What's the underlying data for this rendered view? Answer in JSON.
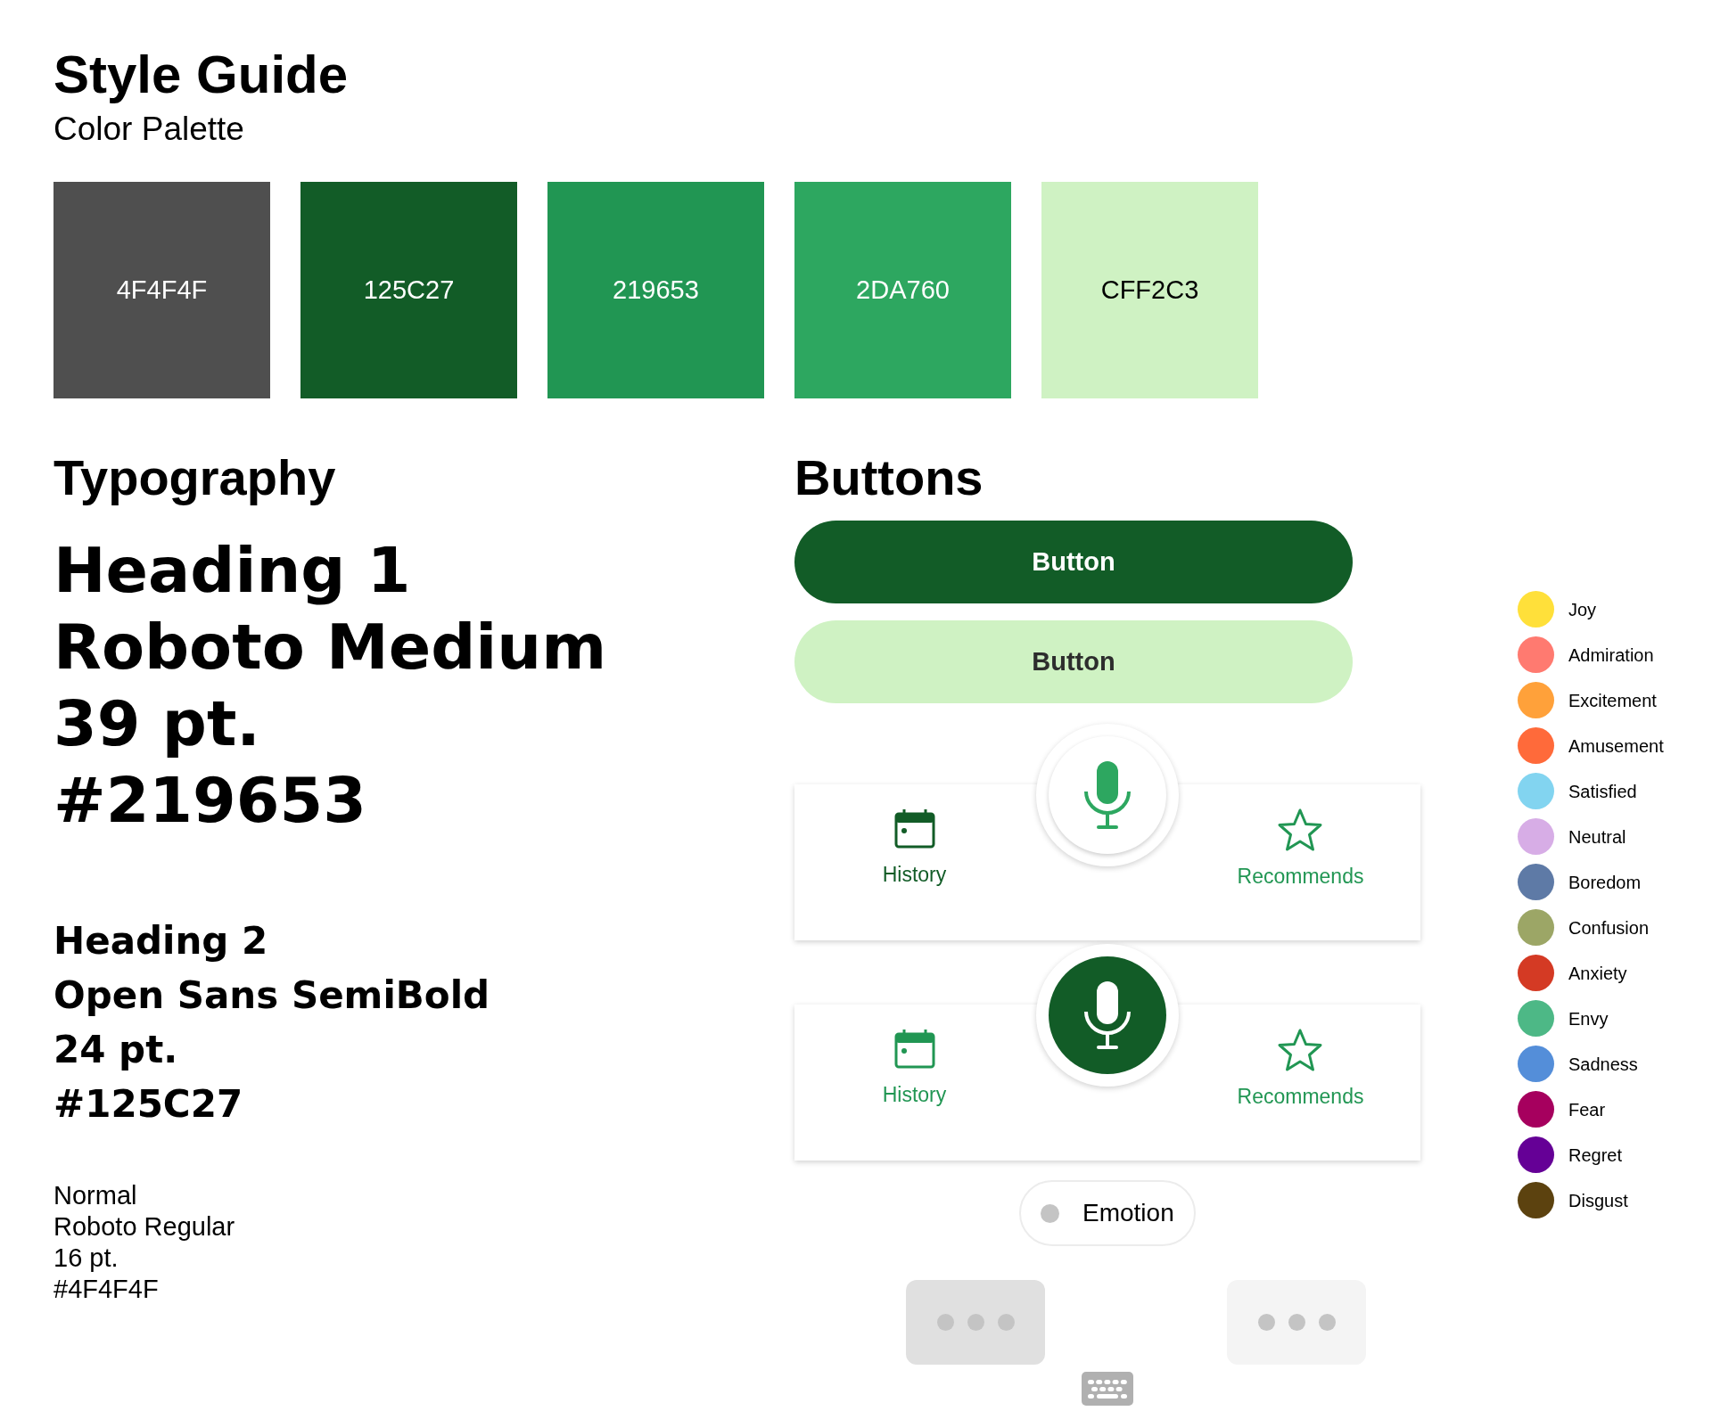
{
  "title": "Style Guide",
  "palette": {
    "heading": "Color Palette",
    "swatches": [
      {
        "label": "4F4F4F",
        "color": "#4f4f4f"
      },
      {
        "label": "125C27",
        "color": "#125c27"
      },
      {
        "label": "219653",
        "color": "#219653"
      },
      {
        "label": "2DA760",
        "color": "#2da760"
      },
      {
        "label": "CFF2C3",
        "color": "#cff2c3"
      }
    ]
  },
  "typography": {
    "heading": "Typography",
    "samples": [
      {
        "kind": "heading1",
        "lines": [
          "Heading 1",
          "Roboto Medium",
          "39 pt.",
          "#219653"
        ]
      },
      {
        "kind": "heading2",
        "lines": [
          "Heading 2",
          "Open Sans SemiBold",
          "24 pt.",
          "#125C27"
        ]
      },
      {
        "kind": "normal",
        "lines": [
          "Normal",
          "Roboto Regular",
          "16 pt.",
          "#4F4F4F"
        ]
      }
    ]
  },
  "buttons": {
    "heading": "Buttons",
    "items": [
      {
        "label": "Button",
        "kind": "primary"
      },
      {
        "label": "Button",
        "kind": "secondary"
      }
    ],
    "nav_bars": [
      {
        "mic_active": false,
        "items": [
          {
            "label": "History",
            "selected": true
          },
          {
            "label": "Recommends",
            "selected": false
          }
        ]
      },
      {
        "mic_active": true,
        "items": [
          {
            "label": "History",
            "selected": false
          },
          {
            "label": "Recommends",
            "selected": false
          }
        ]
      }
    ],
    "chip": {
      "label": "Emotion"
    },
    "typing_indicators": [
      {
        "kind": "dark"
      },
      {
        "kind": "light"
      }
    ]
  },
  "emotions": [
    {
      "label": "Joy",
      "color": "#ffe03a"
    },
    {
      "label": "Admiration",
      "color": "#ff7a70"
    },
    {
      "label": "Excitement",
      "color": "#ffa13a"
    },
    {
      "label": "Amusement",
      "color": "#ff6a3a"
    },
    {
      "label": "Satisfied",
      "color": "#82d4f0"
    },
    {
      "label": "Neutral",
      "color": "#d7ade6"
    },
    {
      "label": "Boredom",
      "color": "#5e7aa6"
    },
    {
      "label": "Confusion",
      "color": "#9ca666"
    },
    {
      "label": "Anxiety",
      "color": "#d43a24"
    },
    {
      "label": "Envy",
      "color": "#4db886"
    },
    {
      "label": "Sadness",
      "color": "#548ed9"
    },
    {
      "label": "Fear",
      "color": "#a6005e"
    },
    {
      "label": "Regret",
      "color": "#650096"
    },
    {
      "label": "Disgust",
      "color": "#5c420f"
    }
  ]
}
